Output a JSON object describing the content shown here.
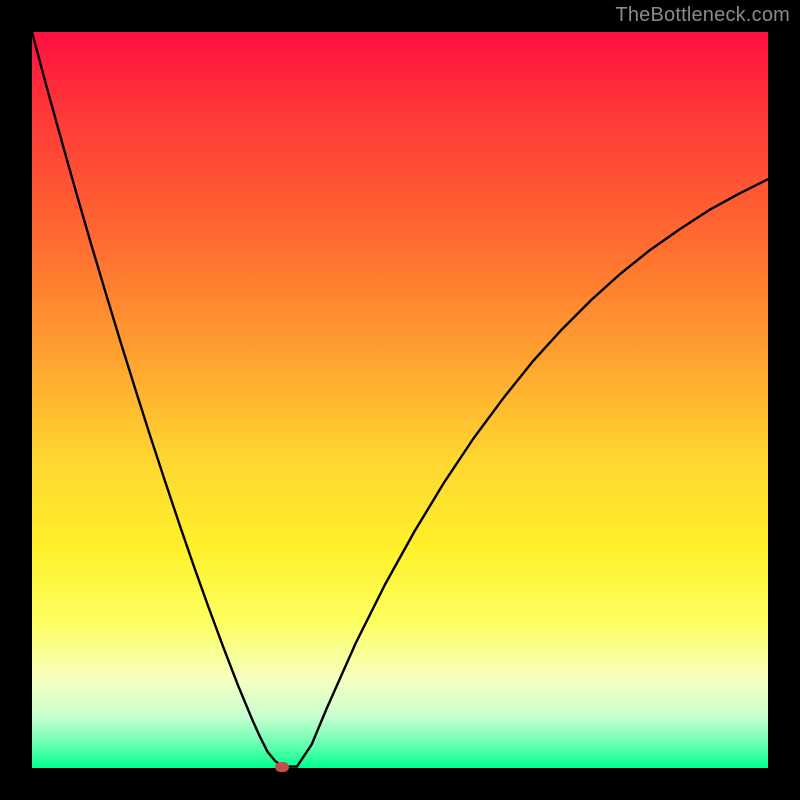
{
  "watermark": "TheBottleneck.com",
  "chart_data": {
    "type": "line",
    "title": "",
    "xlabel": "",
    "ylabel": "",
    "xlim": [
      0,
      100
    ],
    "ylim": [
      0,
      100
    ],
    "x": [
      0,
      2,
      4,
      6,
      8,
      10,
      12,
      14,
      16,
      18,
      20,
      22,
      24,
      26,
      27,
      28,
      29,
      30,
      31,
      32,
      33,
      34,
      36,
      38,
      40,
      44,
      48,
      52,
      56,
      60,
      64,
      68,
      72,
      76,
      80,
      84,
      88,
      92,
      96,
      100
    ],
    "values": [
      100,
      92.5,
      85.3,
      78.2,
      71.3,
      64.6,
      58.0,
      51.6,
      45.3,
      39.2,
      33.2,
      27.4,
      21.8,
      16.4,
      13.8,
      11.2,
      8.8,
      6.4,
      4.2,
      2.2,
      1.0,
      0.2,
      0.2,
      3.2,
      8.0,
      17.0,
      25.0,
      32.2,
      38.8,
      44.8,
      50.2,
      55.2,
      59.6,
      63.6,
      67.2,
      70.4,
      73.2,
      75.8,
      78.0,
      80.0
    ],
    "marker": {
      "x": 34,
      "y": 0.2
    },
    "background_gradient": {
      "top": "#ff1040",
      "middle": "#ffe030",
      "bottom": "#00ff90"
    }
  }
}
